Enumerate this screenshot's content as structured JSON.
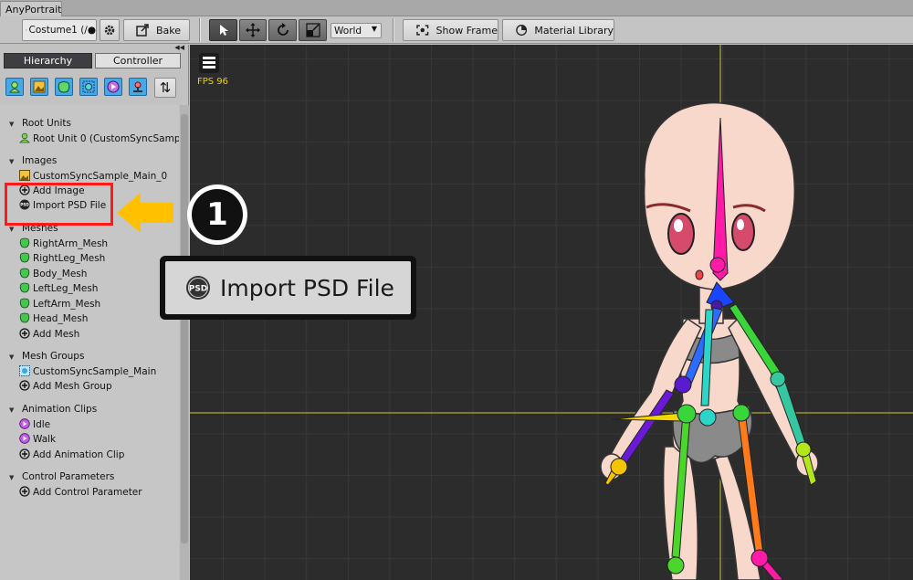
{
  "window": {
    "tab_title": "AnyPortrait"
  },
  "toolbar": {
    "costume_select": "Costume1 (∕●",
    "bake_label": "Bake",
    "space_select": "World",
    "show_frame_label": "Show Frame",
    "material_library_label": "Material Library",
    "tools": [
      "select-tool",
      "move-tool",
      "rotate-tool",
      "scale-tool"
    ]
  },
  "panel": {
    "tabs": [
      "Hierarchy",
      "Controller"
    ],
    "active_tab": "Hierarchy",
    "filter_icons": [
      "root-unit-filter-icon",
      "image-filter-icon",
      "mesh-filter-icon",
      "mesh-group-filter-icon",
      "animation-filter-icon",
      "control-param-filter-icon"
    ],
    "sort_icon": "sort-icon"
  },
  "tree": {
    "root_units": {
      "header": "Root Units",
      "items": [
        "Root Unit 0 (CustomSyncSample_M"
      ]
    },
    "images": {
      "header": "Images",
      "items": [
        "CustomSyncSample_Main_0",
        "Add Image",
        "Import PSD File"
      ]
    },
    "meshes": {
      "header": "Meshes",
      "items": [
        "RightArm_Mesh",
        "RightLeg_Mesh",
        "Body_Mesh",
        "LeftLeg_Mesh",
        "LeftArm_Mesh",
        "Head_Mesh",
        "Add Mesh"
      ]
    },
    "mesh_groups": {
      "header": "Mesh Groups",
      "items": [
        "CustomSyncSample_Main",
        "Add Mesh Group"
      ]
    },
    "animation_clips": {
      "header": "Animation Clips",
      "items": [
        "Idle",
        "Walk",
        "Add Animation Clip"
      ]
    },
    "control_parameters": {
      "header": "Control Parameters",
      "items": [
        "Add Control Parameter"
      ]
    }
  },
  "viewport": {
    "fps_text": "FPS 96"
  },
  "annotation": {
    "step_number": "1",
    "callout_text": "Import PSD File",
    "highlight_color": "#ff1a1a",
    "arrow_color": "#ffc000"
  }
}
